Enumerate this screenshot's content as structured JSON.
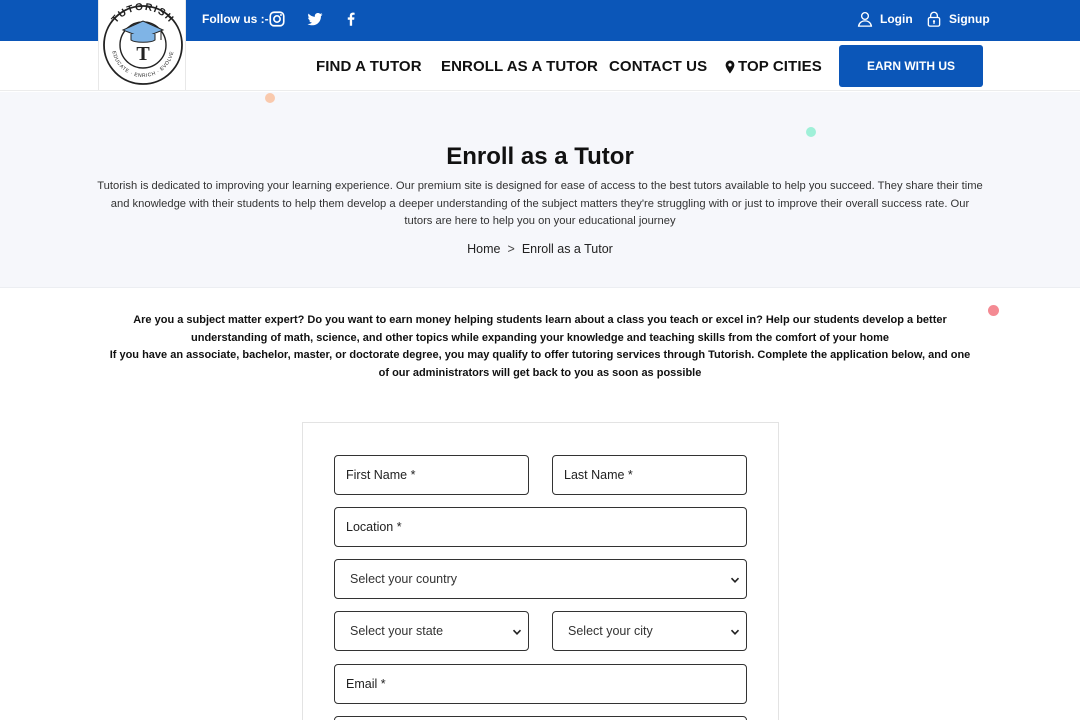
{
  "topbar": {
    "follow_label": "Follow us :-",
    "login_label": "Login",
    "signup_label": "Signup"
  },
  "logo": {
    "text_top": "TUTORISH",
    "text_bottom": "EDUCATE · ENRICH · EVOLVE",
    "letter": "T"
  },
  "nav": {
    "items": [
      {
        "label": "FIND A TUTOR"
      },
      {
        "label": "ENROLL AS A TUTOR"
      },
      {
        "label": "CONTACT US"
      },
      {
        "label": "TOP CITIES"
      }
    ],
    "cta_label": "EARN WITH US"
  },
  "hero": {
    "title": "Enroll as a Tutor",
    "description": "Tutorish is dedicated to improving your learning experience. Our premium site is designed for ease of access to the best tutors available to help you succeed. They share their time and knowledge with their students to help them develop a deeper understanding of the subject matters they're struggling with or just to improve their overall success rate. Our tutors are here to help you on your educational journey",
    "breadcrumb": {
      "home": "Home",
      "separator": ">",
      "current": "Enroll as a Tutor"
    }
  },
  "intro": {
    "paragraph1": "Are you a subject matter expert? Do you want to earn money helping students learn about a class you teach or excel in? Help our students develop a better understanding of math, science, and other topics while expanding your knowledge and teaching skills from the comfort of your home",
    "paragraph2": "If you have an associate, bachelor, master, or doctorate degree, you may qualify to offer tutoring services through Tutorish. Complete the application below, and one of our administrators will get back to you as soon as possible"
  },
  "form": {
    "first_name": "First Name *",
    "last_name": "Last Name *",
    "location": "Location *",
    "country_select": "Select your country",
    "state_select": "Select your state",
    "city_select": "Select your city",
    "email": "Email *"
  },
  "colors": {
    "brand_blue": "#0b56b8",
    "hero_bg": "#f6f7fb",
    "dot_peach": "#f9c9ad",
    "dot_mint": "#9ff0d8",
    "dot_pink": "#f48a93"
  }
}
